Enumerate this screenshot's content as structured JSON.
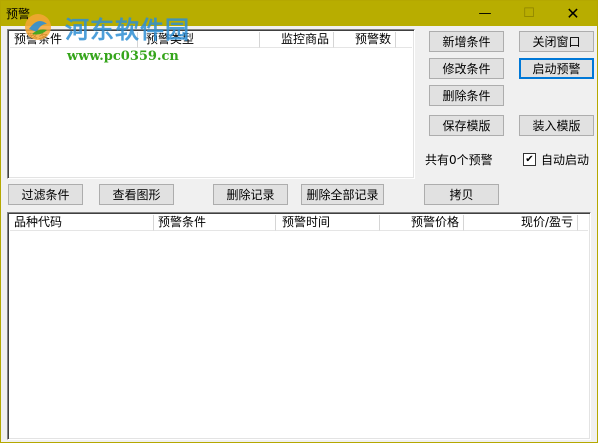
{
  "window": {
    "title": "预警",
    "minimize_glyph": "—",
    "maximize_glyph": "☐",
    "close_glyph": "✕"
  },
  "watermark": {
    "name": "河东软件园",
    "url": "www.pc0359.cn"
  },
  "top_list": {
    "columns": [
      "预警条件",
      "预警类型",
      "监控商品",
      "预警数"
    ]
  },
  "right_panel": {
    "add_condition": "新增条件",
    "close_window": "关闭窗口",
    "edit_condition": "修改条件",
    "start_alert": "启动预警",
    "delete_condition": "删除条件",
    "save_template": "保存模版",
    "load_template": "装入模版",
    "alert_count": "共有0个预警",
    "auto_start_label": "自动启动",
    "auto_start_checked": true,
    "check_glyph": "✔"
  },
  "toolbar": {
    "filter_condition": "过滤条件",
    "view_chart": "查看图形",
    "delete_record": "删除记录",
    "delete_all_records": "删除全部记录",
    "copy": "拷贝"
  },
  "bottom_list": {
    "columns": [
      "品种代码",
      "预警条件",
      "预警时间",
      "预警价格",
      "现价/盈亏"
    ]
  }
}
